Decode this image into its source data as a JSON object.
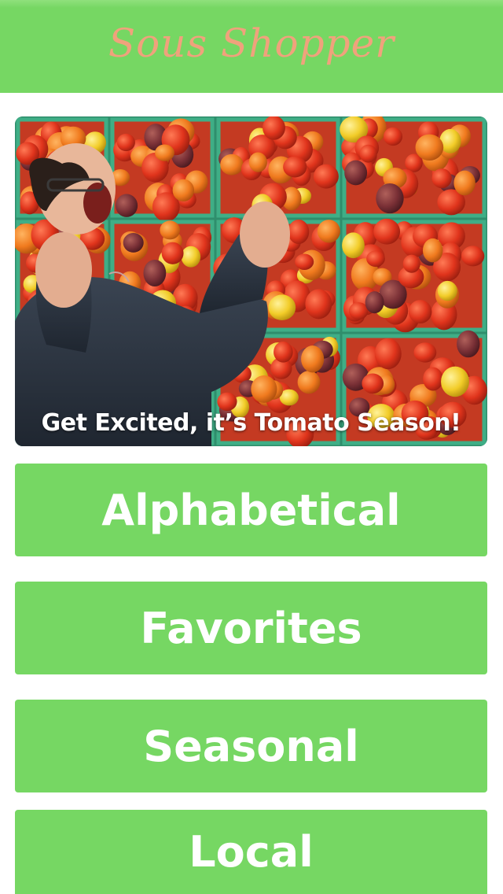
{
  "header": {
    "title": "Sous Shopper"
  },
  "hero": {
    "caption": "Get Excited, it’s Tomato Season!"
  },
  "menu": {
    "items": [
      {
        "label": "Alphabetical"
      },
      {
        "label": "Favorites"
      },
      {
        "label": "Seasonal"
      },
      {
        "label": "Local"
      }
    ]
  },
  "colors": {
    "accent_green": "#76d763",
    "title_salmon": "#f0a27c",
    "button_text": "#ffffff"
  }
}
